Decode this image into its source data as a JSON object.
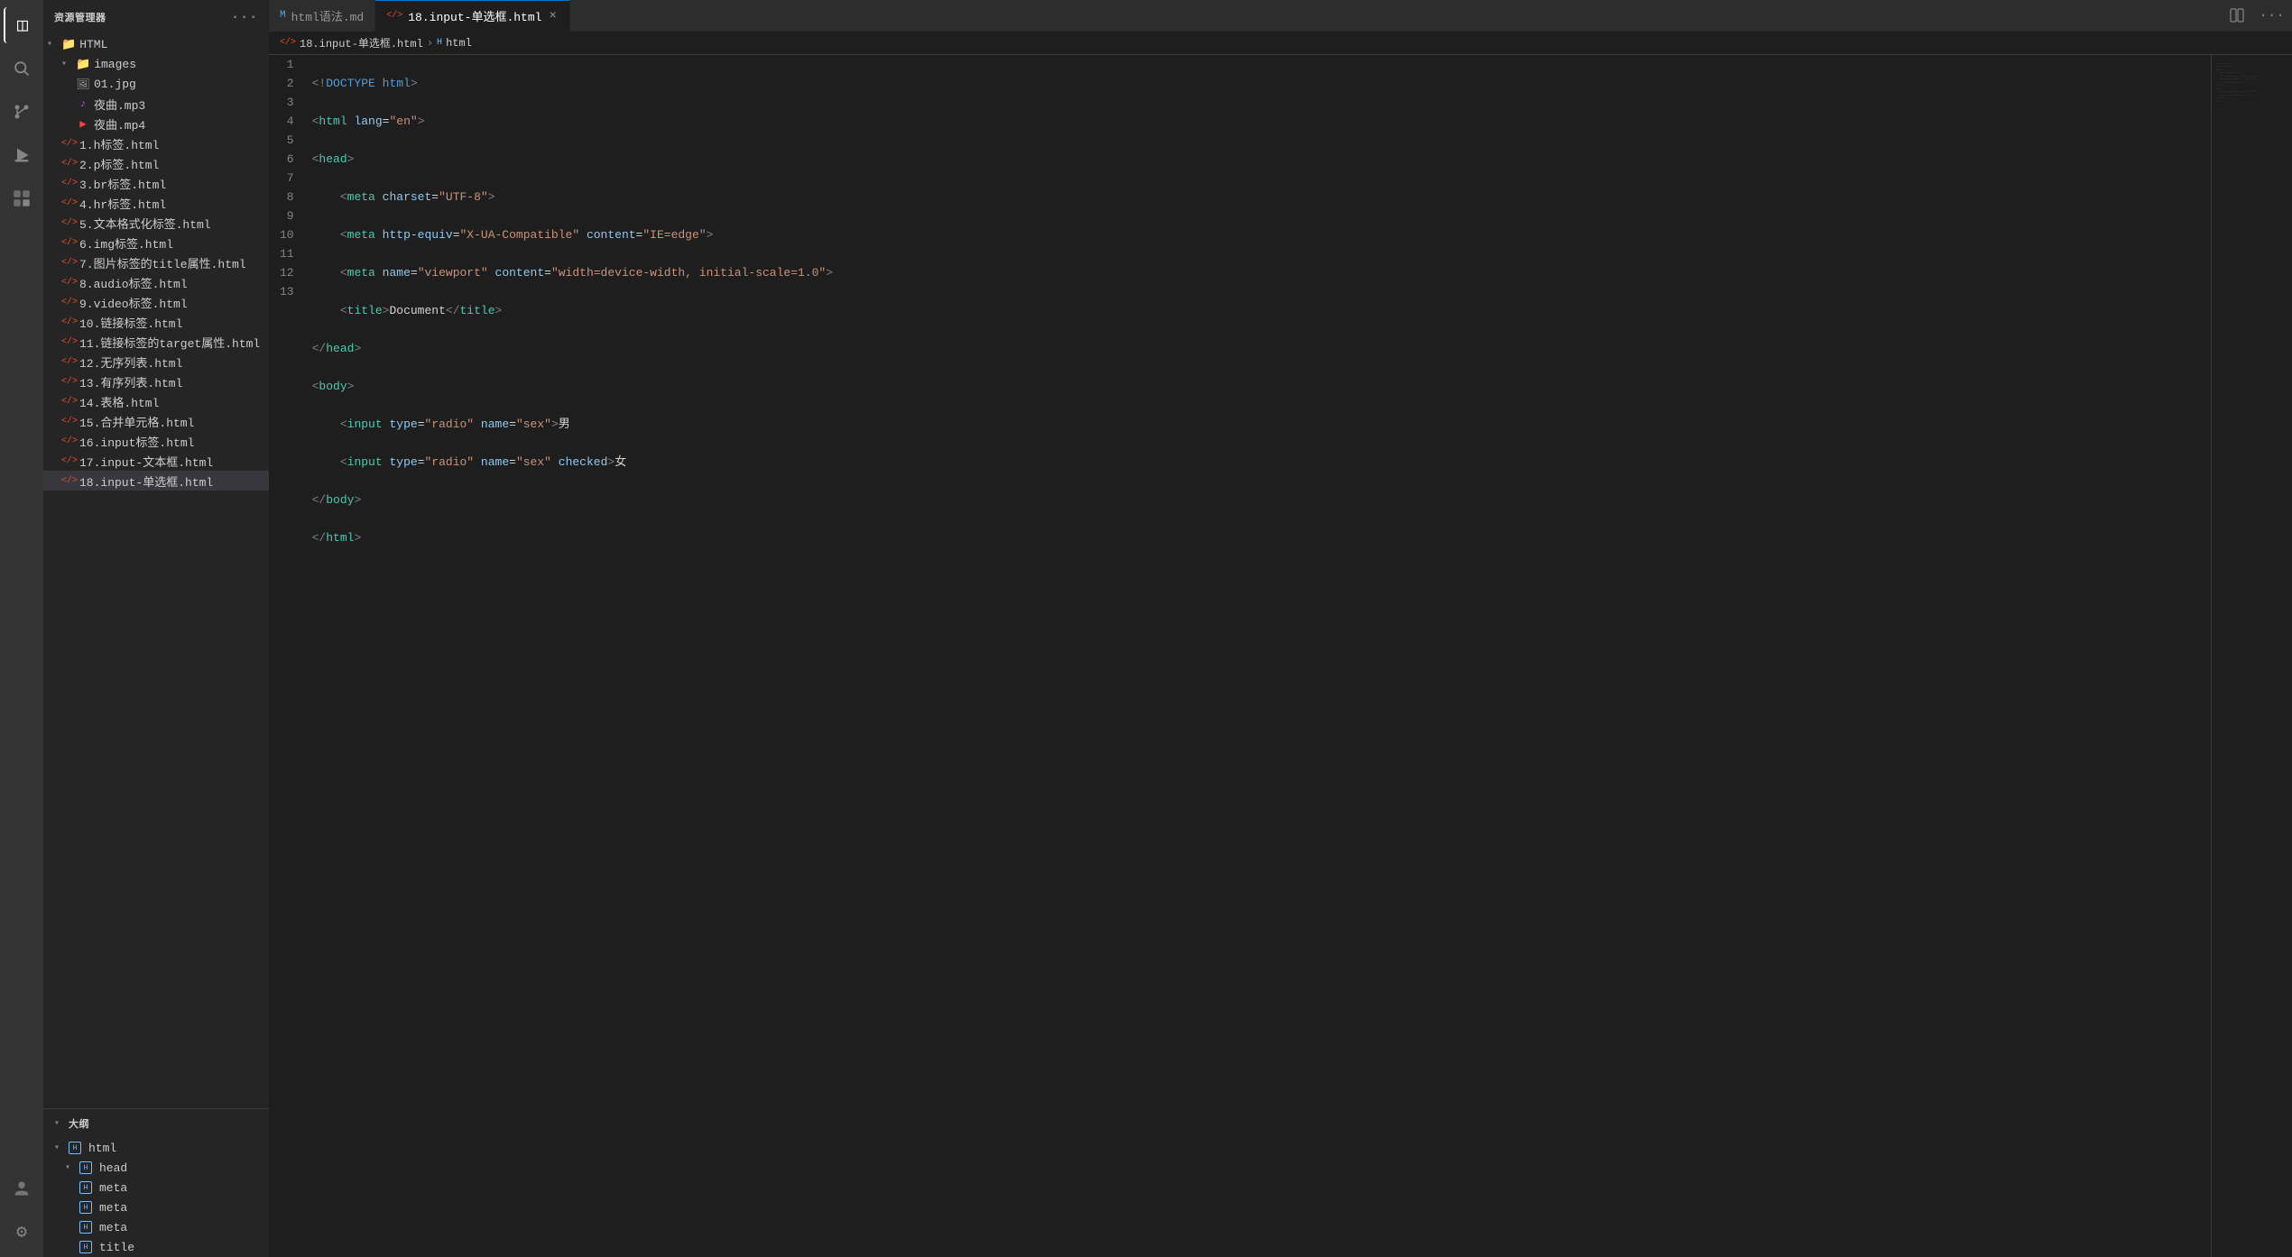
{
  "activityBar": {
    "icons": [
      {
        "name": "explorer-icon",
        "symbol": "⊞",
        "active": true
      },
      {
        "name": "search-icon",
        "symbol": "🔍",
        "active": false
      },
      {
        "name": "source-control-icon",
        "symbol": "⎇",
        "active": false
      },
      {
        "name": "run-icon",
        "symbol": "▷",
        "active": false
      },
      {
        "name": "extensions-icon",
        "symbol": "⊡",
        "active": false
      }
    ],
    "bottomIcons": [
      {
        "name": "account-icon",
        "symbol": "◯"
      },
      {
        "name": "settings-icon",
        "symbol": "⚙"
      }
    ]
  },
  "sidebar": {
    "title": "资源管理器",
    "moreButton": "···",
    "fileTree": {
      "rootFolder": "HTML",
      "items": [
        {
          "type": "folder",
          "label": "images",
          "indent": 1,
          "expanded": true
        },
        {
          "type": "file",
          "label": "01.jpg",
          "indent": 2,
          "icon": "img"
        },
        {
          "type": "file",
          "label": "夜曲.mp3",
          "indent": 2,
          "icon": "audio"
        },
        {
          "type": "file",
          "label": "夜曲.mp4",
          "indent": 2,
          "icon": "video"
        },
        {
          "type": "file",
          "label": "1.h标签.html",
          "indent": 1,
          "icon": "html"
        },
        {
          "type": "file",
          "label": "2.p标签.html",
          "indent": 1,
          "icon": "html"
        },
        {
          "type": "file",
          "label": "3.br标签.html",
          "indent": 1,
          "icon": "html"
        },
        {
          "type": "file",
          "label": "4.hr标签.html",
          "indent": 1,
          "icon": "html"
        },
        {
          "type": "file",
          "label": "5.文本格式化标签.html",
          "indent": 1,
          "icon": "html"
        },
        {
          "type": "file",
          "label": "6.img标签.html",
          "indent": 1,
          "icon": "html"
        },
        {
          "type": "file",
          "label": "7.图片标签的title属性.html",
          "indent": 1,
          "icon": "html"
        },
        {
          "type": "file",
          "label": "8.audio标签.html",
          "indent": 1,
          "icon": "html"
        },
        {
          "type": "file",
          "label": "9.video标签.html",
          "indent": 1,
          "icon": "html"
        },
        {
          "type": "file",
          "label": "10.链接标签.html",
          "indent": 1,
          "icon": "html"
        },
        {
          "type": "file",
          "label": "11.链接标签的target属性.html",
          "indent": 1,
          "icon": "html"
        },
        {
          "type": "file",
          "label": "12.无序列表.html",
          "indent": 1,
          "icon": "html"
        },
        {
          "type": "file",
          "label": "13.有序列表.html",
          "indent": 1,
          "icon": "html"
        },
        {
          "type": "file",
          "label": "14.表格.html",
          "indent": 1,
          "icon": "html"
        },
        {
          "type": "file",
          "label": "15.合并单元格.html",
          "indent": 1,
          "icon": "html"
        },
        {
          "type": "file",
          "label": "16.input标签.html",
          "indent": 1,
          "icon": "html"
        },
        {
          "type": "file",
          "label": "17.input-文本框.html",
          "indent": 1,
          "icon": "html"
        },
        {
          "type": "file",
          "label": "18.input-单选框.html",
          "indent": 1,
          "icon": "html",
          "selected": true
        }
      ]
    }
  },
  "outline": {
    "title": "大纲",
    "items": [
      {
        "label": "html",
        "indent": 0,
        "icon": "outline"
      },
      {
        "label": "head",
        "indent": 1,
        "icon": "outline"
      },
      {
        "label": "meta",
        "indent": 2,
        "icon": "outline"
      },
      {
        "label": "meta",
        "indent": 2,
        "icon": "outline"
      },
      {
        "label": "meta",
        "indent": 2,
        "icon": "outline"
      },
      {
        "label": "title",
        "indent": 2,
        "icon": "outline"
      }
    ]
  },
  "tabs": [
    {
      "label": "html语法.md",
      "icon": "md",
      "active": false,
      "closeable": false
    },
    {
      "label": "18.input-单选框.html",
      "icon": "html",
      "active": true,
      "closeable": true
    }
  ],
  "breadcrumb": {
    "items": [
      "18.input-单选框.html",
      "html"
    ]
  },
  "editor": {
    "lines": [
      {
        "num": 1,
        "content": "<!DOCTYPE html>"
      },
      {
        "num": 2,
        "content": "<html lang=\"en\">"
      },
      {
        "num": 3,
        "content": "<head>"
      },
      {
        "num": 4,
        "content": "    <meta charset=\"UTF-8\">"
      },
      {
        "num": 5,
        "content": "    <meta http-equiv=\"X-UA-Compatible\" content=\"IE=edge\">"
      },
      {
        "num": 6,
        "content": "    <meta name=\"viewport\" content=\"width=device-width, initial-scale=1.0\">"
      },
      {
        "num": 7,
        "content": "    <title>Document</title>"
      },
      {
        "num": 8,
        "content": "</head>"
      },
      {
        "num": 9,
        "content": "<body>"
      },
      {
        "num": 10,
        "content": "    <input type=\"radio\" name=\"sex\">男"
      },
      {
        "num": 11,
        "content": "    <input type=\"radio\" name=\"sex\" checked>女"
      },
      {
        "num": 12,
        "content": "</body>"
      },
      {
        "num": 13,
        "content": "</html>"
      }
    ]
  }
}
